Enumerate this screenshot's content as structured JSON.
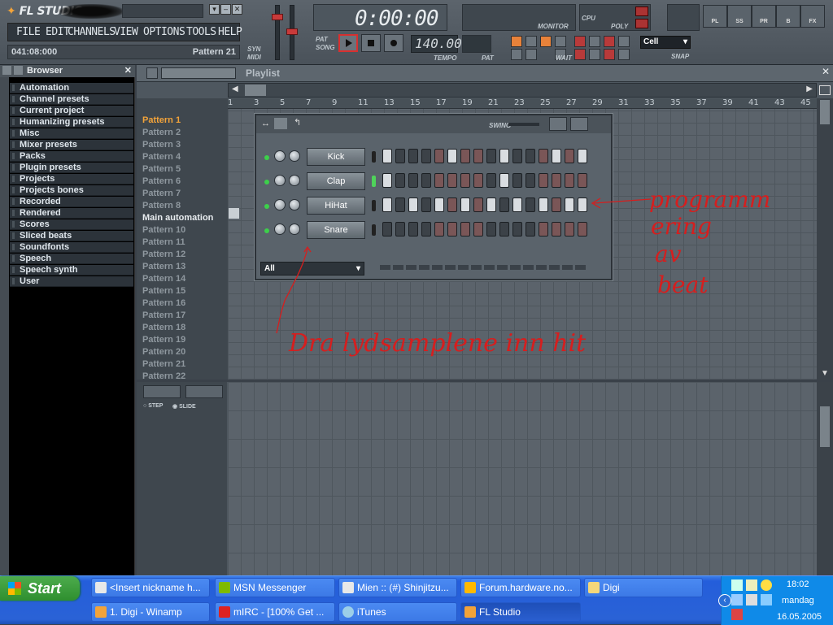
{
  "app": {
    "title": "FL STUDIO",
    "menu": [
      "FILE",
      "EDIT",
      "CHANNELS",
      "VIEW",
      "OPTIONS",
      "TOOLS",
      "HELP"
    ],
    "hint_left": "041:08:000",
    "hint_right": "Pattern 21",
    "clock": "0:00:00",
    "tempo": "140.000",
    "labels": {
      "monitor": "MONITOR",
      "cpu": "CPU",
      "poly": "POLY",
      "tempo": "TEMPO",
      "pat": "PAT",
      "snap": "SNAP",
      "pat_sm": "PAT",
      "song_sm": "SONG",
      "wait": "WAIT",
      "syn": "SYN",
      "midi": "MIDI"
    },
    "snap_value": "Cell",
    "right_buttons": [
      "PL",
      "SS",
      "PR",
      "B",
      "FX"
    ]
  },
  "browser": {
    "title": "Browser",
    "items": [
      "Automation",
      "Channel presets",
      "Current project",
      "Humanizing presets",
      "Misc",
      "Mixer presets",
      "Packs",
      "Plugin presets",
      "Projects",
      "Projects bones",
      "Recorded",
      "Rendered",
      "Scores",
      "Sliced beats",
      "Soundfonts",
      "Speech",
      "Speech synth",
      "User"
    ]
  },
  "playlist": {
    "title": "Playlist",
    "patterns": [
      "Pattern 1",
      "Pattern 2",
      "Pattern 3",
      "Pattern 4",
      "Pattern 5",
      "Pattern 6",
      "Pattern 7",
      "Pattern 8",
      "Main automation",
      "Pattern 10",
      "Pattern 11",
      "Pattern 12",
      "Pattern 13",
      "Pattern 14",
      "Pattern 15",
      "Pattern 16",
      "Pattern 17",
      "Pattern 18",
      "Pattern 19",
      "Pattern 20",
      "Pattern 21",
      "Pattern 22"
    ],
    "ruler": [
      "1",
      "3",
      "5",
      "7",
      "9",
      "11",
      "13",
      "15",
      "17",
      "19",
      "21",
      "23",
      "25",
      "27",
      "29",
      "31",
      "33",
      "35",
      "37",
      "39",
      "41",
      "43",
      "45"
    ]
  },
  "step_sequencer": {
    "swing_label": "SWING",
    "filter": "All",
    "channels": [
      {
        "name": "Kick",
        "steps": "1000010001000101"
      },
      {
        "name": "Clap",
        "steps": "1000000001000000"
      },
      {
        "name": "HiHat",
        "steps": "1010101010101011"
      },
      {
        "name": "Snare",
        "steps": "0000000000000000"
      }
    ]
  },
  "piano_roll": {
    "step_label": "STEP",
    "slide_label": "SLIDE"
  },
  "annotations": {
    "right": [
      "programm",
      "ering",
      "av",
      "beat"
    ],
    "bottom": "Dra lydsamplene inn hit"
  },
  "taskbar": {
    "start": "Start",
    "row1": [
      "<Insert nickname h...",
      "MSN Messenger",
      "Mien :: (#) Shinjitzu...",
      "Forum.hardware.no...",
      "Digi"
    ],
    "row2": [
      "1. Digi - Winamp",
      "mIRC - [100% Get ...",
      "iTunes",
      "FL Studio"
    ],
    "time": "18:02",
    "day": "mandag",
    "date": "16.05.2005"
  }
}
